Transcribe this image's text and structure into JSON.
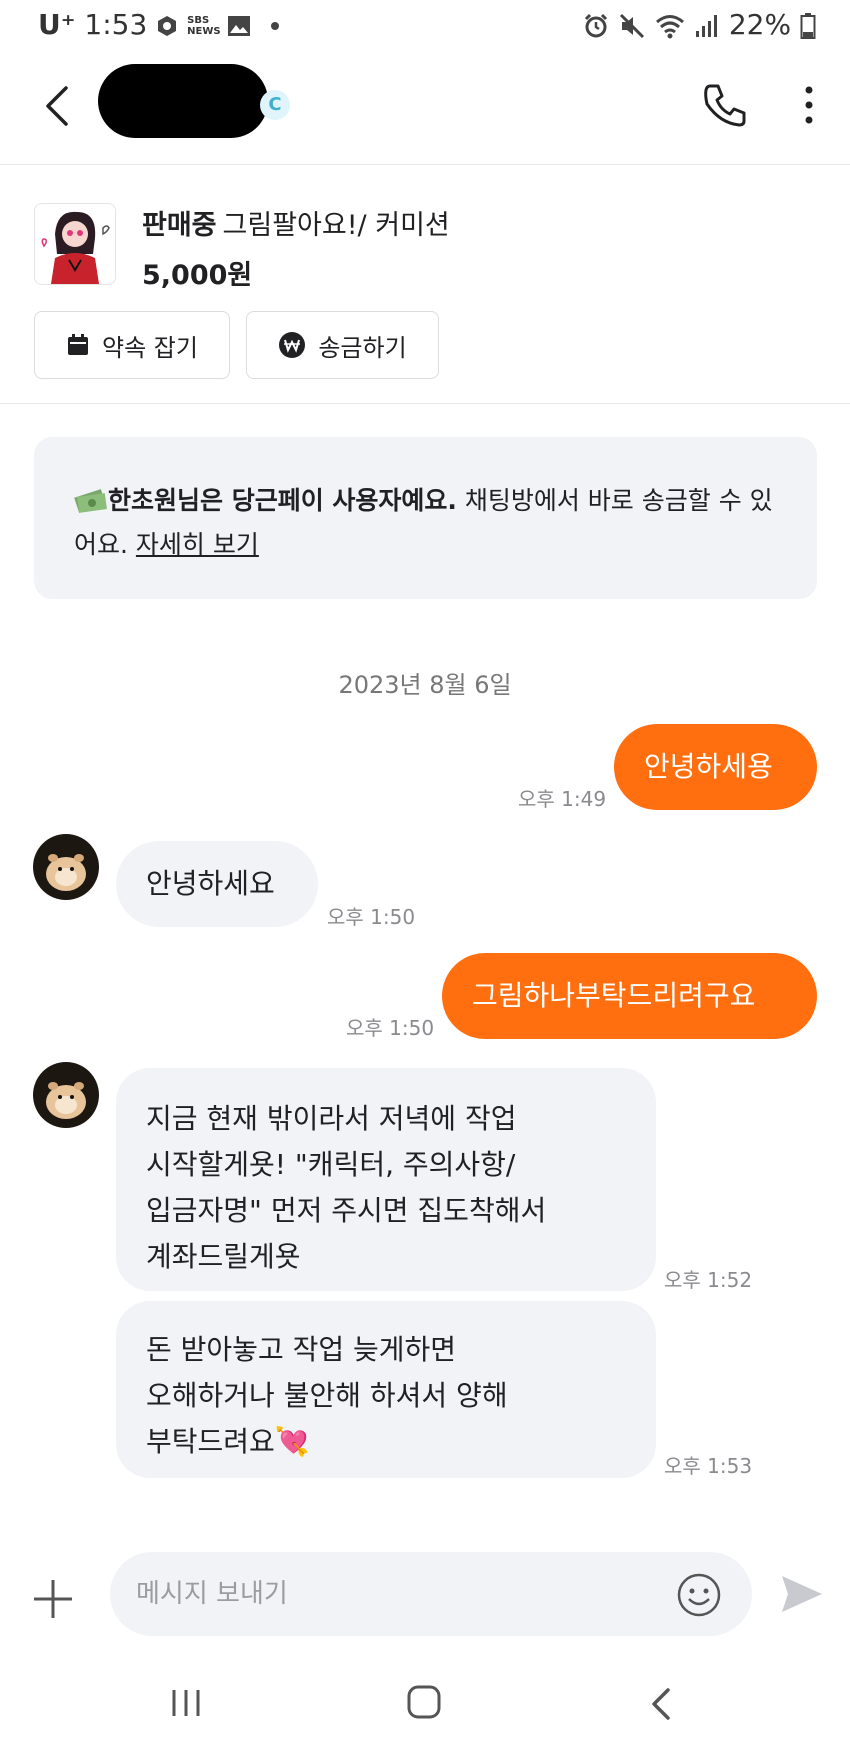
{
  "status_bar": {
    "carrier": "U⁺",
    "time": "1:53",
    "news_label": "SBS NEWS",
    "battery": "22%",
    "icons": [
      "alarm-icon",
      "mute-icon",
      "wifi-icon",
      "signal-icon",
      "battery-icon"
    ]
  },
  "header": {
    "icons": [
      "back-arrow-icon",
      "phone-icon",
      "more-vertical-icon"
    ]
  },
  "product": {
    "status": "판매중",
    "title": "그림팔아요!/ 커미션",
    "price": "5,000원",
    "appointment_label": "약속 잡기",
    "send_money_label": "송금하기"
  },
  "notice": {
    "bold_text": "한초원님은 당근페이 사용자예요.",
    "text": " 채팅방에서 바로 송금할 수 있어요. ",
    "link": "자세히 보기"
  },
  "chat": {
    "date": "2023년 8월 6일",
    "messages": [
      {
        "from": "me",
        "text": "안녕하세용",
        "time": "오후 1:49"
      },
      {
        "from": "them",
        "text": "안녕하세요",
        "time": "오후 1:50"
      },
      {
        "from": "me",
        "text": "그림하나부탁드리려구요",
        "time": "오후 1:50"
      },
      {
        "from": "them",
        "lines": [
          "지금 현재 밖이라서 저녁에 작업",
          "시작할게욧! \"캐릭터, 주의사항/",
          "입금자명\" 먼저 주시면 집도착해서",
          "계좌드릴게욧"
        ],
        "time": "오후 1:52"
      },
      {
        "from": "them",
        "lines": [
          "돈 받아놓고 작업 늦게하면",
          "오해하거나 불안해 하셔서 양해",
          "부탁드려요💘"
        ],
        "time": "오후 1:53"
      }
    ]
  },
  "input": {
    "placeholder": "메시지 보내기"
  },
  "colors": {
    "accent": "#ff6f0f",
    "bubble_other": "#f2f3f6",
    "text": "#212124"
  }
}
